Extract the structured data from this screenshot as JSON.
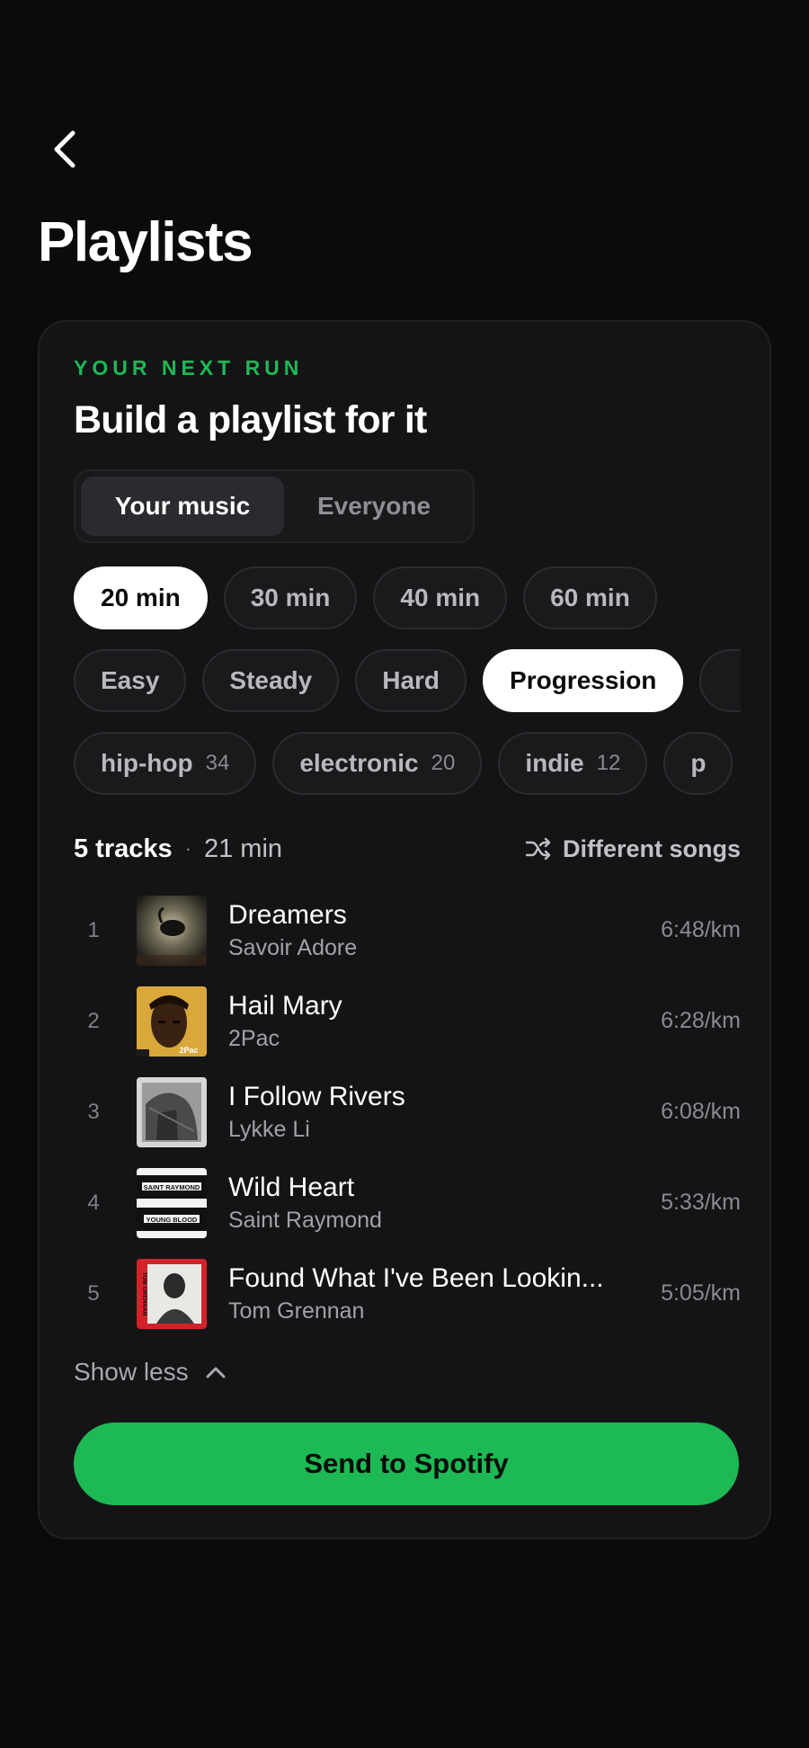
{
  "header": {
    "back_icon": "chevron-left-icon",
    "title": "Playlists"
  },
  "card": {
    "eyebrow": "YOUR NEXT RUN",
    "title": "Build a playlist for it",
    "source_toggle": {
      "options": [
        "Your music",
        "Everyone"
      ],
      "selected": "Your music"
    },
    "durations": [
      {
        "label": "20 min",
        "selected": true
      },
      {
        "label": "30 min",
        "selected": false
      },
      {
        "label": "40 min",
        "selected": false
      },
      {
        "label": "60 min",
        "selected": false
      }
    ],
    "intensities": [
      {
        "label": "Easy",
        "selected": false
      },
      {
        "label": "Steady",
        "selected": false
      },
      {
        "label": "Hard",
        "selected": false
      },
      {
        "label": "Progression",
        "selected": true
      }
    ],
    "genres": [
      {
        "label": "hip-hop",
        "count": "34"
      },
      {
        "label": "electronic",
        "count": "20"
      },
      {
        "label": "indie",
        "count": "12"
      },
      {
        "label": "p",
        "count": ""
      }
    ],
    "tracks_summary": {
      "count": "5 tracks",
      "separator": "·",
      "duration": "21 min",
      "shuffle_icon": "shuffle-icon",
      "shuffle_label": "Different songs"
    },
    "tracks": [
      {
        "num": "1",
        "title": "Dreamers",
        "artist": "Savoir Adore",
        "pace": "6:48/km"
      },
      {
        "num": "2",
        "title": "Hail Mary",
        "artist": "2Pac",
        "pace": "6:28/km"
      },
      {
        "num": "3",
        "title": "I Follow Rivers",
        "artist": "Lykke Li",
        "pace": "6:08/km"
      },
      {
        "num": "4",
        "title": "Wild Heart",
        "artist": "Saint Raymond",
        "pace": "5:33/km"
      },
      {
        "num": "5",
        "title": "Found What I've Been Lookin...",
        "artist": "Tom Grennan",
        "pace": "5:05/km"
      }
    ],
    "album_art_text": {
      "hail_mary": "2Pac",
      "wild_heart_top": "SAINT RAYMOND",
      "wild_heart_bottom": "YOUNG BLOOD",
      "tom_grennan": "TOM GRENNAN"
    },
    "show_less": "Show less",
    "send_button": "Send to Spotify"
  },
  "colors": {
    "background": "#0b0b0c",
    "card": "#141416",
    "accent_green": "#1db954",
    "text_primary": "#ffffff",
    "text_secondary": "#a2a2a7"
  }
}
